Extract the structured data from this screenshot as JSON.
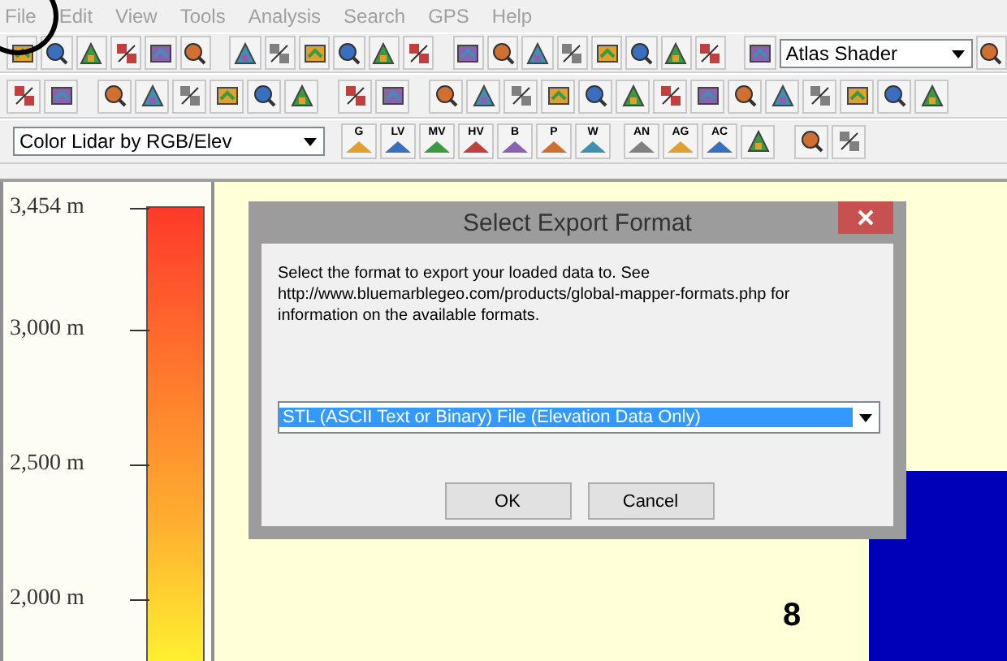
{
  "menu": [
    {
      "label": "File",
      "disabled": true
    },
    {
      "label": "Edit",
      "disabled": true
    },
    {
      "label": "View",
      "disabled": true
    },
    {
      "label": "Tools",
      "disabled": true
    },
    {
      "label": "Analysis",
      "disabled": true
    },
    {
      "label": "Search",
      "disabled": true
    },
    {
      "label": "GPS",
      "disabled": true
    },
    {
      "label": "Help",
      "disabled": true
    }
  ],
  "toolbar": {
    "shader_select": "Atlas Shader"
  },
  "toolbar_3": {
    "layer_select": "Color Lidar by RGB/Elev",
    "button_labels": [
      "G",
      "LV",
      "MV",
      "HV",
      "B",
      "P",
      "W",
      "AN",
      "AG",
      "AC"
    ]
  },
  "legend": {
    "labels": [
      "3,454 m",
      "3,000 m",
      "2,500 m",
      "2,000 m"
    ]
  },
  "map": {
    "label": "8"
  },
  "dialog": {
    "title": "Select Export Format",
    "message": "Select the format to export your loaded data to. See http://www.bluemarblegeo.com/products/global-mapper-formats.php for information on the available formats.",
    "format_select": "STL (ASCII Text or Binary) File (Elevation Data Only)",
    "buttons": [
      "OK",
      "Cancel"
    ]
  }
}
